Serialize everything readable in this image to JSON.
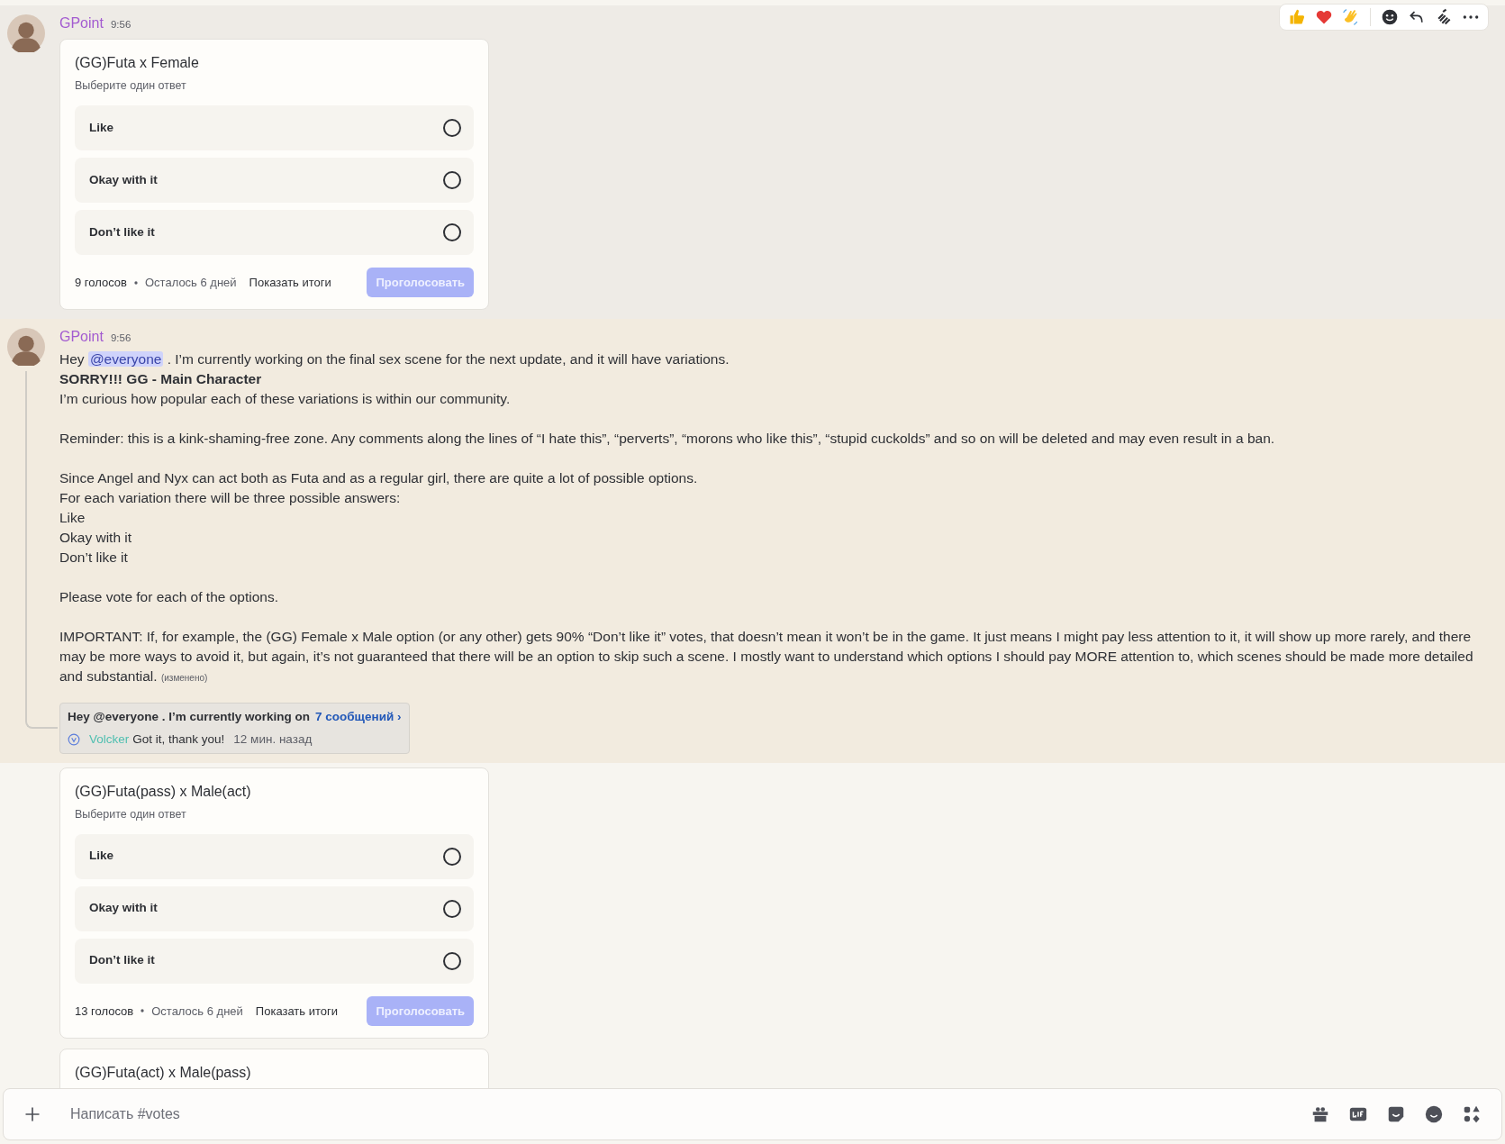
{
  "messages": [
    {
      "kind": "message",
      "author": "GPoint",
      "time": "9:56",
      "hovered": true,
      "highlighted": false,
      "poll": {
        "question": "(GG)Futa x Female",
        "hint": "Выберите один ответ",
        "options": [
          {
            "label": "Like",
            "selected": false
          },
          {
            "label": "Okay with it",
            "selected": false
          },
          {
            "label": "Don’t like it",
            "selected": false
          }
        ],
        "votes": "9 голосов",
        "remaining": "Осталось 6 дней",
        "results_button": "Показать итоги",
        "vote_button": {
          "label": "Проголосовать",
          "disabled": true
        }
      }
    },
    {
      "kind": "message",
      "author": "GPoint",
      "time": "9:56",
      "hovered": false,
      "highlighted": true,
      "paragraphs": [
        [
          {
            "kind": "mention_line",
            "before": "Hey ",
            "mention": "@everyone",
            "after": " . I’m currently working on the final sex scene for the next update, and it will have variations."
          },
          {
            "kind": "bold",
            "text": "SORRY!!! GG - Main Character"
          },
          {
            "kind": "text",
            "text": "I’m curious how popular each of these variations is within our community."
          }
        ],
        [
          {
            "kind": "text",
            "text": "Reminder: this is a kink-shaming-free zone. Any comments along the lines of “I hate this”, “perverts”, “morons who like this”, “stupid cuckolds” and so on will be deleted and may even result in a ban."
          }
        ],
        [
          {
            "kind": "text",
            "text": "Since Angel and Nyx can act both as Futa and as a regular girl, there are quite a lot of possible options."
          },
          {
            "kind": "text",
            "text": "For each variation there will be three possible answers:"
          },
          {
            "kind": "text",
            "text": "Like"
          },
          {
            "kind": "text",
            "text": "Okay with it"
          },
          {
            "kind": "text",
            "text": "Don’t like it"
          }
        ],
        [
          {
            "kind": "text",
            "text": "Please vote for each of the options."
          }
        ],
        [
          {
            "kind": "text",
            "text": "IMPORTANT: If, for example, the (GG) Female x Male option (or any other) gets 90% “Don’t like it” votes, that doesn’t mean it won’t be in the game. It just means I might pay less attention to it, it will show up more rarely, and there may be more ways to avoid it, but again, it’s not guaranteed that there will be an option to skip such a scene. I mostly want to understand which options I should pay MORE attention to, which scenes should be made more detailed and substantial."
          }
        ]
      ],
      "edited": "(изменено)",
      "thread": {
        "preview": "Hey @everyone . I’m currently working on",
        "count": "7 сообщений ›",
        "reply_author": "Volcker",
        "reply_text": "Got it, thank you!",
        "reply_time": "12 мин. назад"
      }
    },
    {
      "kind": "poll",
      "poll": {
        "question": "(GG)Futa(pass) x Male(act)",
        "hint": "Выберите один ответ",
        "options": [
          {
            "label": "Like",
            "selected": false
          },
          {
            "label": "Okay with it",
            "selected": false
          },
          {
            "label": "Don’t like it",
            "selected": false
          }
        ],
        "votes": "13 голосов",
        "remaining": "Осталось 6 дней",
        "results_button": "Показать итоги",
        "vote_button": {
          "label": "Проголосовать",
          "disabled": true
        }
      }
    },
    {
      "kind": "poll",
      "poll": {
        "question": "(GG)Futa(act) x Male(pass)"
      }
    }
  ],
  "composer": {
    "placeholder": "Написать #votes"
  }
}
